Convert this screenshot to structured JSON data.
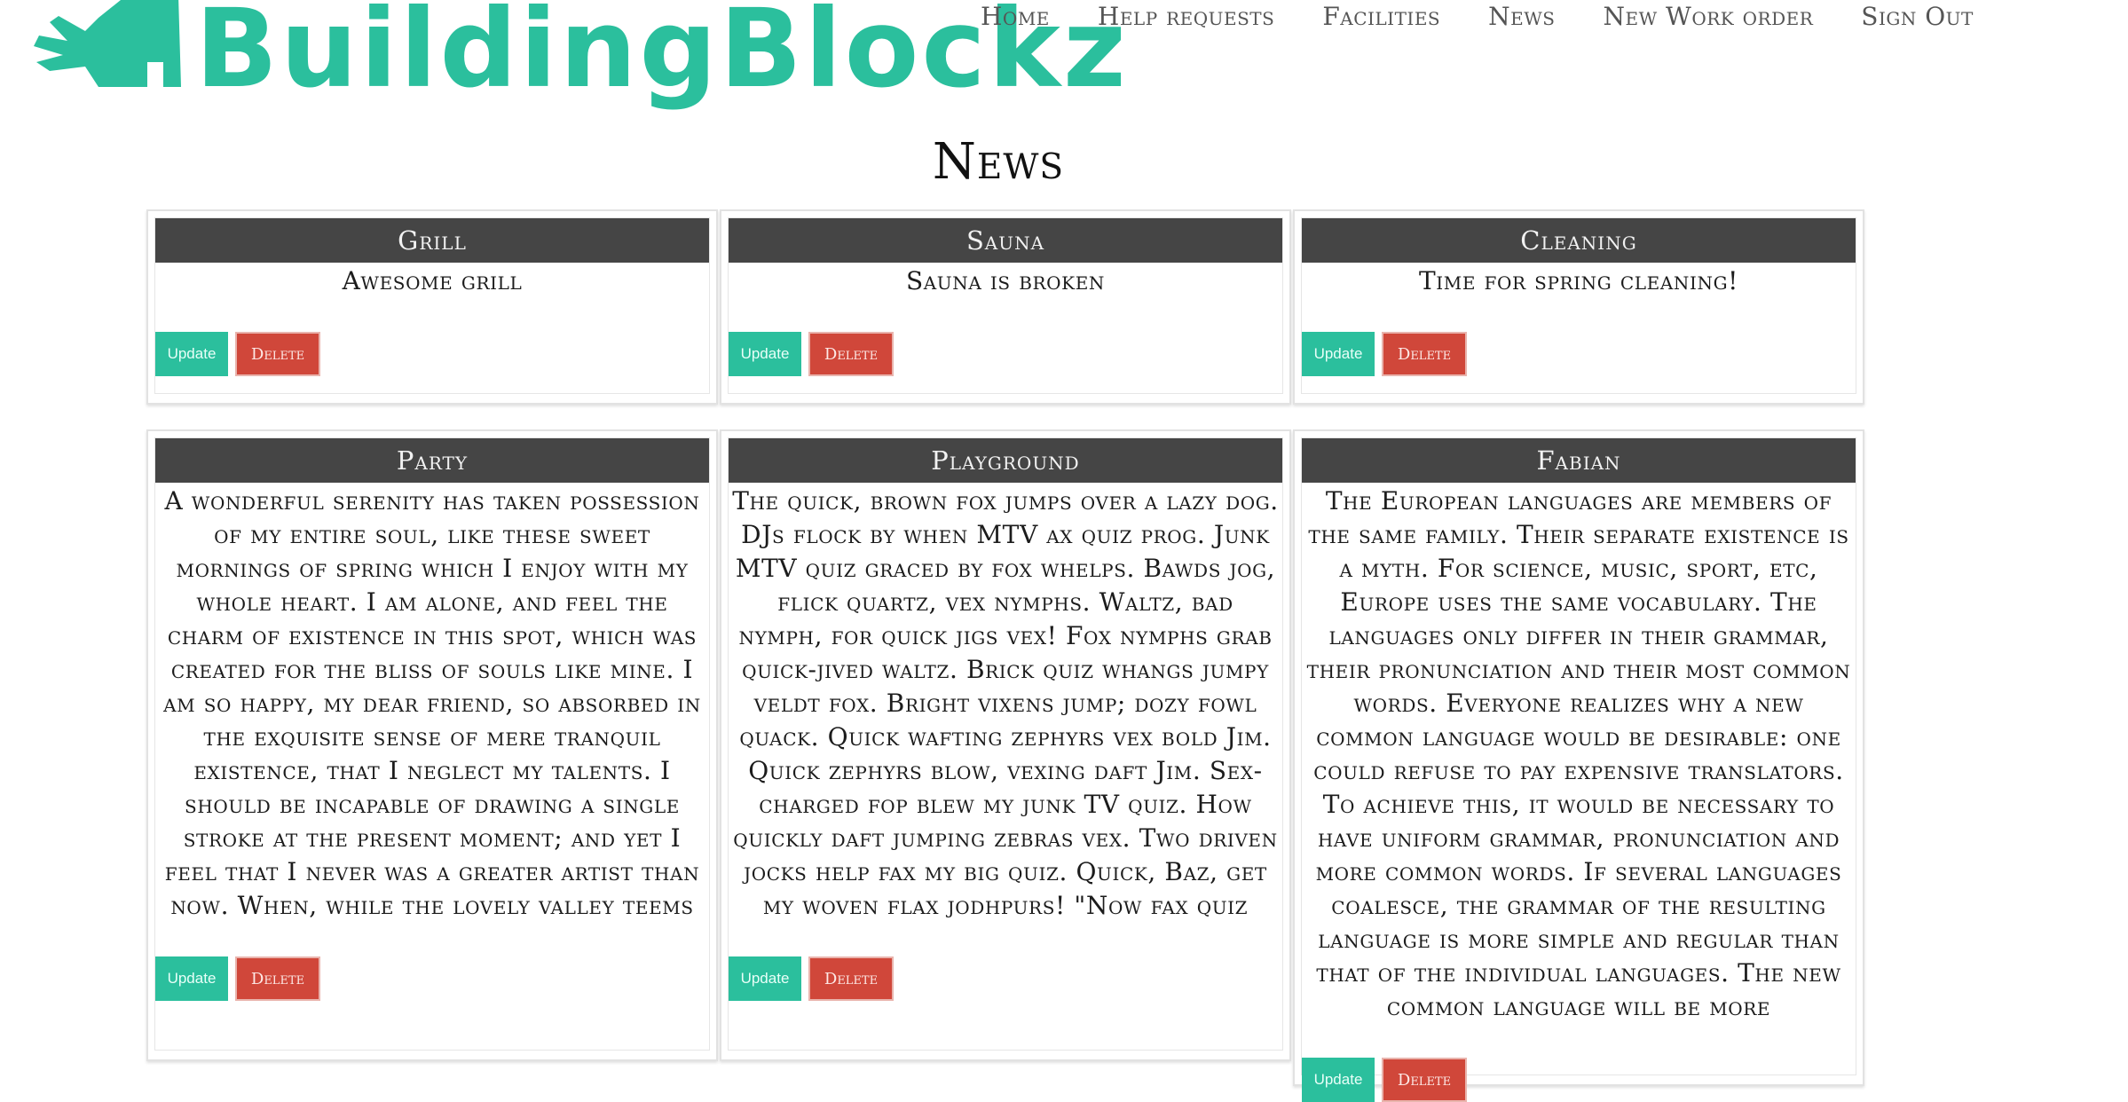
{
  "brand": {
    "name": "BuildingBlockz",
    "color": "#2bbf9d"
  },
  "nav": [
    "Home",
    "Help requests",
    "Facilities",
    "News",
    "New Work order",
    "Sign Out"
  ],
  "page_title": "News",
  "buttons": {
    "update": "Update",
    "delete": "Delete"
  },
  "colors": {
    "header": "#454545",
    "update": "#2bbf9d",
    "delete": "#d0473a"
  },
  "cards": [
    {
      "title": "Grill",
      "body": "Awesome grill"
    },
    {
      "title": "Sauna",
      "body": "Sauna is broken"
    },
    {
      "title": "Cleaning",
      "body": "Time for spring cleaning!"
    },
    {
      "title": "Party",
      "body": "A wonderful serenity has taken possession of my entire soul, like these sweet mornings of spring which I enjoy with my whole heart. I am alone, and feel the charm of existence in this spot, which was created for the bliss of souls like mine. I am so happy, my dear friend, so absorbed in the exquisite sense of mere tranquil existence, that I neglect my talents. I should be incapable of drawing a single stroke at the present moment; and yet I feel that I never was a greater artist than now. When, while the lovely valley teems with"
    },
    {
      "title": "Playground",
      "body": "The quick, brown fox jumps over a lazy dog. DJs flock by when MTV ax quiz prog. Junk MTV quiz graced by fox whelps. Bawds jog, flick quartz, vex nymphs. Waltz, bad nymph, for quick jigs vex! Fox nymphs grab quick-jived waltz. Brick quiz whangs jumpy veldt fox. Bright vixens jump; dozy fowl quack. Quick wafting zephyrs vex bold Jim. Quick zephyrs blow, vexing daft Jim. Sex-charged fop blew my junk TV quiz. How quickly daft jumping zebras vex. Two driven jocks help fax my big quiz. Quick, Baz, get my woven flax jodhpurs! \"Now fax quiz Jack!\" my brave"
    },
    {
      "title": "Fabian",
      "body": "The European languages are members of the same family. Their separate existence is a myth. For science, music, sport, etc, Europe uses the same vocabulary. The languages only differ in their grammar, their pronunciation and their most common words. Everyone realizes why a new common language would be desirable: one could refuse to pay expensive translators. To achieve this, it would be necessary to have uniform grammar, pronunciation and more common words. If several languages coalesce, the grammar of the resulting language is more simple and regular than that of the individual languages. The new common language will be more"
    }
  ]
}
